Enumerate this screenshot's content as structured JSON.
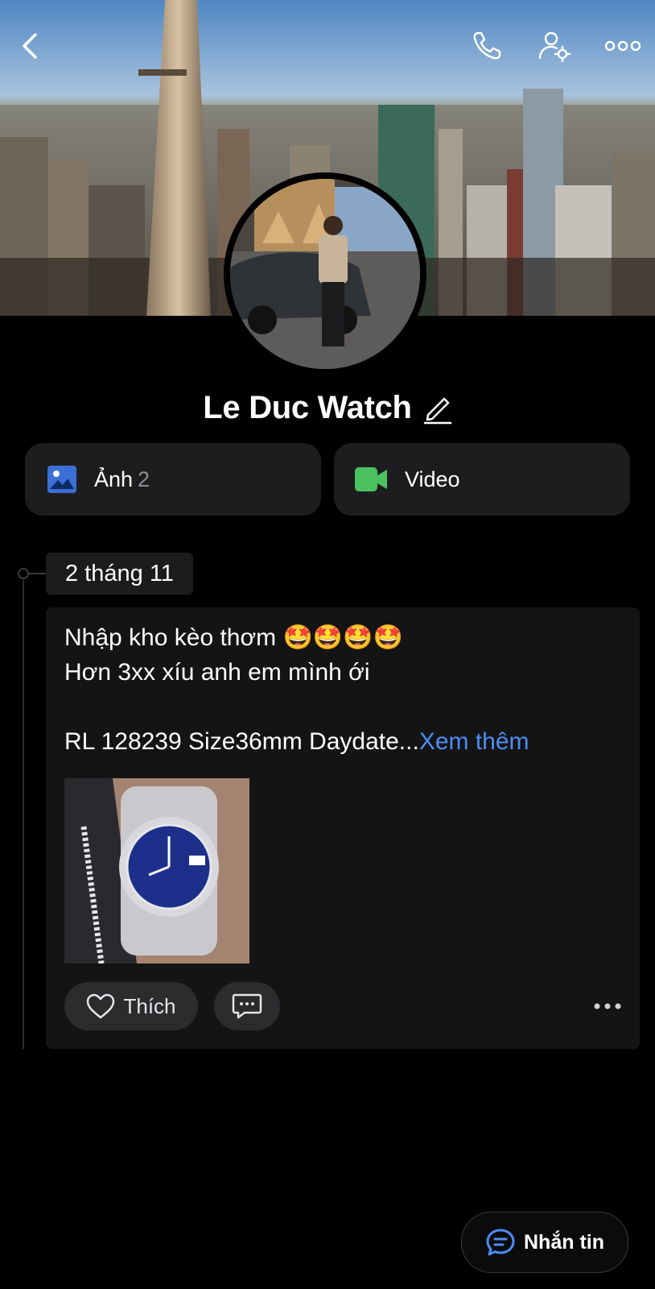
{
  "profile": {
    "name": "Le Duc Watch"
  },
  "tiles": {
    "photos": {
      "label": "Ảnh",
      "count": "2",
      "icon": "photo-icon",
      "color": "#3b6fd6"
    },
    "video": {
      "label": "Video",
      "icon": "video-icon",
      "color": "#4cc15f"
    }
  },
  "timeline": {
    "date": "2 tháng 11"
  },
  "post": {
    "text": "Nhập kho kèo thơm 🤩🤩🤩🤩\nHơn 3xx xíu anh em mình ới\n\nRL 128239 Size36mm Daydate...",
    "see_more": "Xem thêm",
    "like_label": "Thích"
  },
  "bottom": {
    "message_label": "Nhắn tin"
  },
  "colors": {
    "accent": "#4c8df6",
    "background": "#000000",
    "card": "#141414"
  }
}
